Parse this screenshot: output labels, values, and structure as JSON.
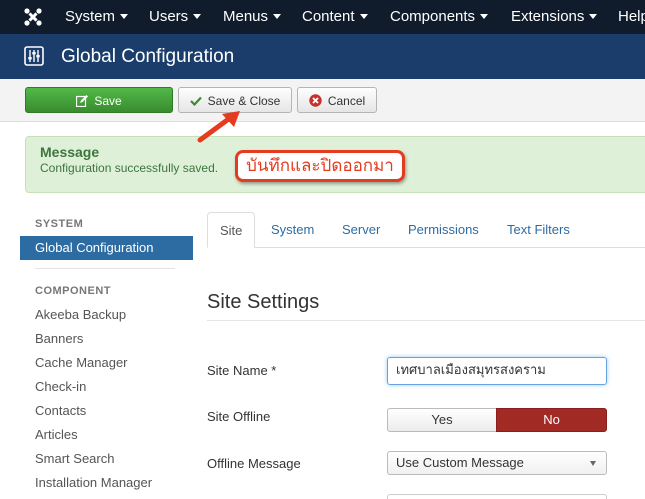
{
  "topbar": {
    "menu": [
      {
        "label": "System"
      },
      {
        "label": "Users"
      },
      {
        "label": "Menus"
      },
      {
        "label": "Content"
      },
      {
        "label": "Components"
      },
      {
        "label": "Extensions"
      },
      {
        "label": "Help"
      }
    ]
  },
  "header": {
    "title": "Global Configuration"
  },
  "toolbar": {
    "save_label": "Save",
    "save_close_label": "Save & Close",
    "cancel_label": "Cancel"
  },
  "alert": {
    "title": "Message",
    "text": "Configuration successfully saved."
  },
  "annotation": {
    "text": "บันทึกและปิดออกมา",
    "color": "#e53b1e"
  },
  "sidebar": {
    "system_heading": "SYSTEM",
    "active_item": "Global Configuration",
    "component_heading": "COMPONENT",
    "items": [
      {
        "label": "Akeeba Backup"
      },
      {
        "label": "Banners"
      },
      {
        "label": "Cache Manager"
      },
      {
        "label": "Check-in"
      },
      {
        "label": "Contacts"
      },
      {
        "label": "Articles"
      },
      {
        "label": "Smart Search"
      },
      {
        "label": "Installation Manager"
      }
    ]
  },
  "tabs": [
    {
      "label": "Site",
      "active": true
    },
    {
      "label": "System"
    },
    {
      "label": "Server"
    },
    {
      "label": "Permissions"
    },
    {
      "label": "Text Filters"
    }
  ],
  "main": {
    "section_title": "Site Settings",
    "site_name_label": "Site Name *",
    "site_name_value": "เทศบาลเมืองสมุทรสงคราม",
    "site_offline_label": "Site Offline",
    "offline_yes": "Yes",
    "offline_no": "No",
    "offline_message_label": "Offline Message",
    "offline_message_value": "Use Custom Message"
  },
  "colors": {
    "topbar": "#101b2b",
    "header": "#1b3d6b",
    "save_button": "#46a546",
    "sidebar_active": "#2d6ca2",
    "alert_bg": "#dff0d8",
    "offline_no": "#a12a25"
  }
}
